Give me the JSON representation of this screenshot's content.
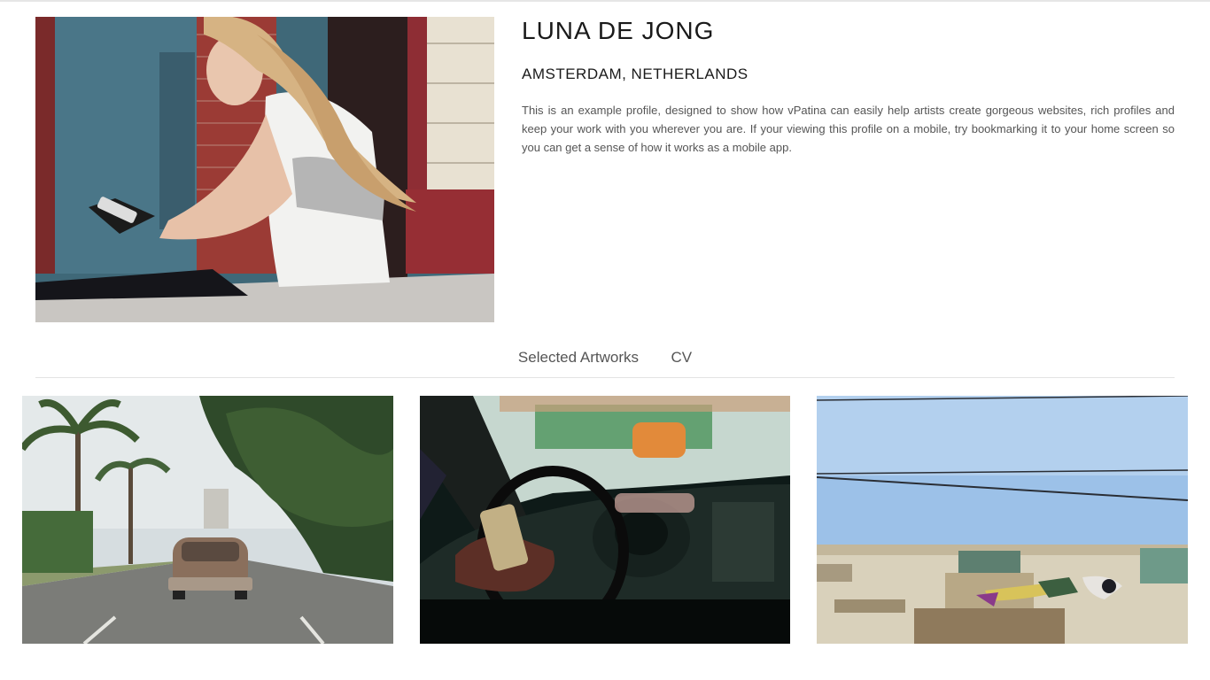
{
  "profile": {
    "name": "LUNA DE JONG",
    "location": "AMSTERDAM, NETHERLANDS",
    "bio": "This is an example profile, designed to show how vPatina can easily help artists create gorgeous websites, rich profiles and keep your work with you wherever you are. If your viewing this profile on a mobile, try bookmarking it to your home screen so you can get a sense of how it works as a mobile app."
  },
  "tabs": [
    {
      "label": "Selected Artworks"
    },
    {
      "label": "CV"
    }
  ],
  "artworks": [
    {
      "subject": "vintage car on palm-lined avenue"
    },
    {
      "subject": "hand on car steering wheel"
    },
    {
      "subject": "sky over old building facade"
    }
  ]
}
